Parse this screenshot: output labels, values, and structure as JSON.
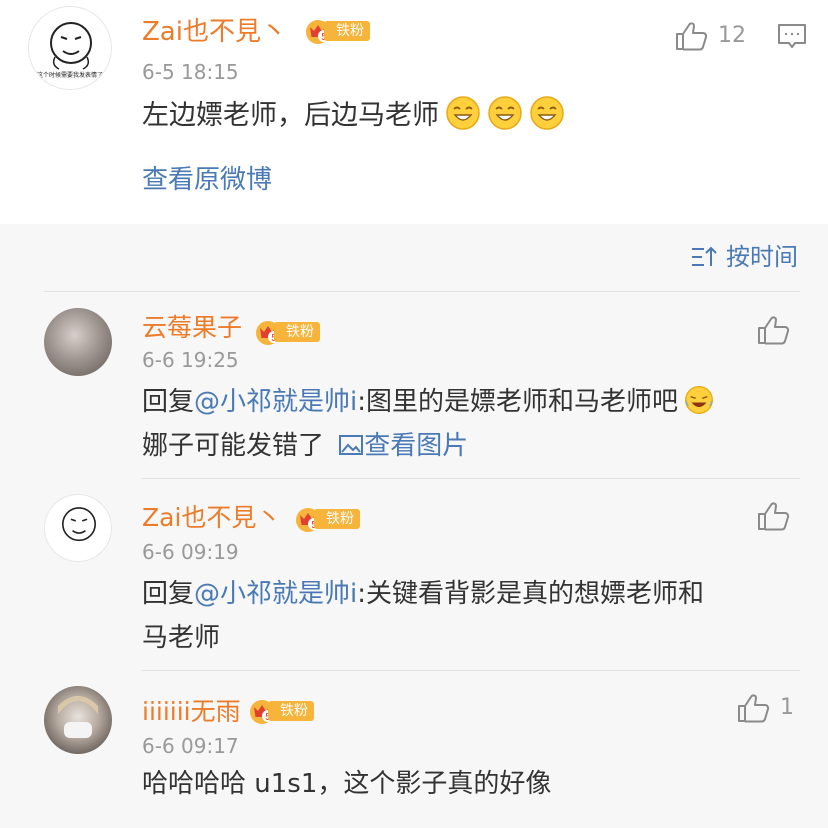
{
  "post": {
    "author": "Zai也不見丶",
    "badge": "铁粉",
    "badge_level": "5",
    "time": "6-5 18:15",
    "text": "左边嫖老师，后边马老师",
    "like_count": "12",
    "view_original": "查看原微博",
    "avatar_caption": "这个时候需要我发表情了"
  },
  "sort_label": "按时间",
  "comments": [
    {
      "author": "云莓果子",
      "badge": "铁粉",
      "badge_level": "5",
      "time": "6-6 19:25",
      "reply_prefix": "回复",
      "mention": "@小祁就是帅i",
      "line1_rest": ":图里的是嫖老师和马老师吧",
      "line2": "娜子可能发错了",
      "view_image": "查看图片"
    },
    {
      "author": "Zai也不見丶",
      "badge": "铁粉",
      "badge_level": "5",
      "time": "6-6 09:19",
      "reply_prefix": "回复",
      "mention": "@小祁就是帅i",
      "line1_rest": ":关键看背影是真的想嫖老师和",
      "line2": "马老师"
    },
    {
      "author": "iiiiiii无雨",
      "badge": "铁粉",
      "badge_level": "5",
      "time": "6-6 09:17",
      "text": "哈哈哈哈 u1s1，这个影子真的好像",
      "like_count": "1"
    }
  ],
  "colors": {
    "name": "#ec7c2a",
    "link": "#4a7ab5",
    "badge": "#f6b43b",
    "meta": "#999999"
  }
}
